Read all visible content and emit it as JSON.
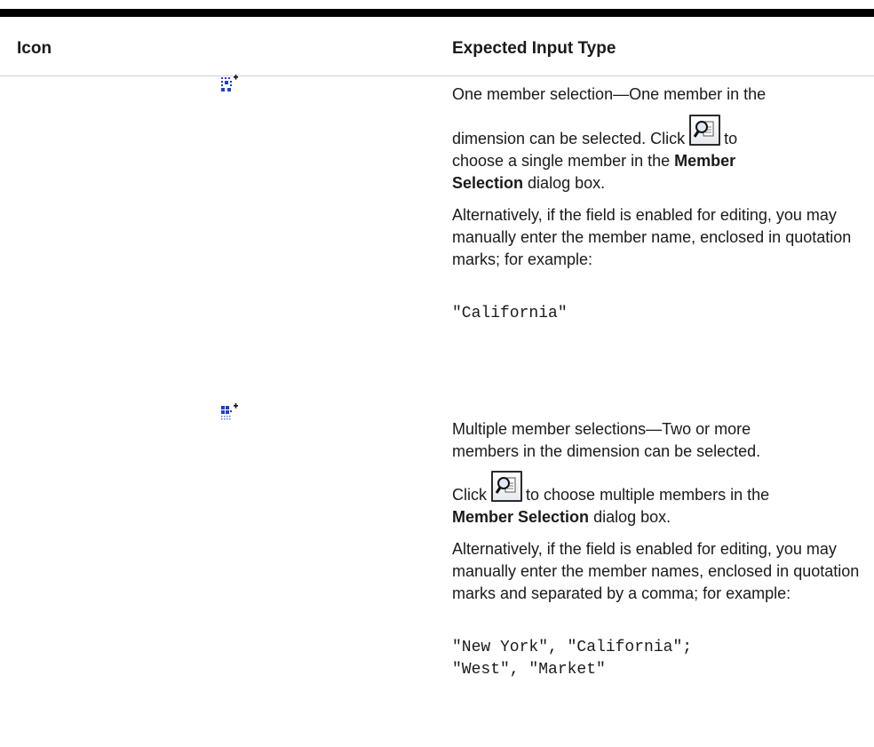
{
  "header": {
    "col_icon": "Icon",
    "col_type": "Expected Input Type"
  },
  "rows": [
    {
      "icon": "single-member-selection-icon",
      "line1": "One member selection—One member in the",
      "line2_pre": "dimension can be selected. Click",
      "line2_post": "to",
      "line3_pre": "choose a single member in the",
      "bold_a": "Member",
      "bold_b": "Selection",
      "line4_post": "dialog box.",
      "alt": "Alternatively, if the field is enabled for editing, you may manually enter the member name, enclosed in quotation marks; for example:",
      "code1": "\"California\""
    },
    {
      "icon": "multiple-member-selection-icon",
      "line1": "Multiple member selections—Two or more",
      "line2": "members in the dimension can be selected.",
      "line3_pre": "Click",
      "line3_post": "to choose multiple members in the",
      "bold": "Member Selection",
      "line4_post": "dialog box.",
      "alt": "Alternatively, if the field is enabled for editing, you may manually enter the member names, enclosed in quotation marks and separated by a comma; for example:",
      "code1": "\"New York\", \"California\";",
      "code2": "\"West\", \"Market\""
    }
  ],
  "colors": {
    "icon_blue": "#1f3fd0",
    "rule_black": "#000000"
  }
}
